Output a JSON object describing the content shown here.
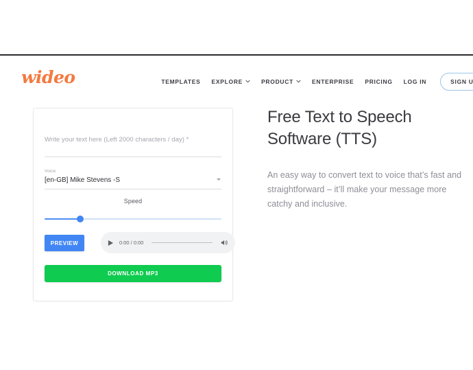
{
  "header": {
    "logo_text": "wideo",
    "logo_color": "#f4793f",
    "nav": [
      {
        "label": "TEMPLATES",
        "caret": false
      },
      {
        "label": "EXPLORE",
        "caret": true
      },
      {
        "label": "PRODUCT",
        "caret": true
      },
      {
        "label": "ENTERPRISE",
        "caret": false
      },
      {
        "label": "PRICING",
        "caret": false
      },
      {
        "label": "LOG IN",
        "caret": false
      }
    ],
    "signup_label": "SIGN UP"
  },
  "card": {
    "text_input": {
      "placeholder": "Write your text here (Left 2000 characters / day) *",
      "value": ""
    },
    "voice": {
      "label": "Voice",
      "selected": "[en-GB] Mike Stevens -S"
    },
    "speed": {
      "label": "Speed",
      "percent": 20
    },
    "preview_label": "PREVIEW",
    "player": {
      "time": "0:00 / 0:00"
    },
    "download_label": "DOWNLOAD MP3"
  },
  "hero": {
    "title": "Free Text to Speech Software (TTS)",
    "subtitle": "An easy way to convert text to voice that’s fast and straightforward – it’ll make your message more catchy and inclusive."
  },
  "colors": {
    "brand_orange": "#f4793f",
    "accent_blue": "#4186f4",
    "success_green": "#0fcb4f"
  }
}
